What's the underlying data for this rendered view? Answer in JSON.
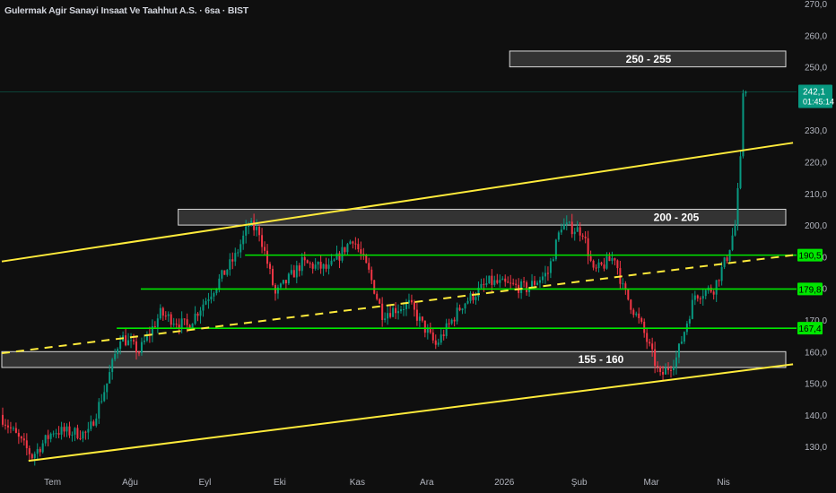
{
  "header": {
    "title": "Gulermak Agir Sanayi Insaat Ve Taahhut A.S. · 6sa · BIST"
  },
  "colors": {
    "background": "#0f0f0f",
    "up": "#089981",
    "down": "#f23645",
    "trendline": "#ffeb3b",
    "level": "#00e600",
    "zone_fill": "#3a3a3a",
    "zone_border": "#d9d9d9",
    "last_price": "#089981"
  },
  "chart_data": {
    "type": "candlestick",
    "title": "Gulermak Agir Sanayi Insaat Ve Taahhut A.S. · 6sa · BIST",
    "y_ticks": [
      "270,0",
      "260,0",
      "250,0",
      "240,0",
      "230,0",
      "220,0",
      "210,0",
      "200,0",
      "190,0",
      "180,0",
      "170,0",
      "160,0",
      "150,0",
      "140,0",
      "130,0"
    ],
    "y_tick_values": [
      270,
      260,
      250,
      240,
      230,
      220,
      210,
      200,
      190,
      180,
      170,
      160,
      150,
      140,
      130
    ],
    "ylim": [
      123,
      271
    ],
    "x_ticks": [
      "Tem",
      "Ağu",
      "Eyl",
      "Eki",
      "Kas",
      "Ara",
      "2026",
      "Şub",
      "Mar",
      "Nis"
    ],
    "x_tick_bar_index": [
      19,
      48,
      76,
      104,
      133,
      159,
      188,
      216,
      243,
      270
    ],
    "bar_count": 279,
    "price_path_waypoints": [
      [
        0,
        140
      ],
      [
        12,
        127
      ],
      [
        20,
        135
      ],
      [
        33,
        134
      ],
      [
        40,
        150
      ],
      [
        45,
        165
      ],
      [
        52,
        160
      ],
      [
        60,
        172
      ],
      [
        70,
        168
      ],
      [
        80,
        180
      ],
      [
        88,
        190
      ],
      [
        93,
        200
      ],
      [
        97,
        198
      ],
      [
        103,
        178
      ],
      [
        113,
        188
      ],
      [
        123,
        186
      ],
      [
        132,
        196
      ],
      [
        138,
        185
      ],
      [
        143,
        172
      ],
      [
        153,
        175
      ],
      [
        163,
        162
      ],
      [
        173,
        175
      ],
      [
        183,
        182
      ],
      [
        197,
        180
      ],
      [
        205,
        185
      ],
      [
        210,
        200
      ],
      [
        218,
        198
      ],
      [
        222,
        185
      ],
      [
        230,
        190
      ],
      [
        233,
        180
      ],
      [
        240,
        168
      ],
      [
        247,
        152
      ],
      [
        253,
        158
      ],
      [
        260,
        178
      ],
      [
        267,
        180
      ],
      [
        272,
        190
      ],
      [
        275,
        200
      ],
      [
        277,
        220
      ],
      [
        278,
        242.1
      ]
    ],
    "last_price": {
      "value": 242.1,
      "label": "242,1",
      "countdown": "01:45:14"
    },
    "levels": [
      {
        "value": 190.5,
        "label": "190,5",
        "start_bar": 91
      },
      {
        "value": 179.8,
        "label": "179,8",
        "start_bar": 52
      },
      {
        "value": 167.4,
        "label": "167,4",
        "start_bar": 43
      }
    ],
    "zones": [
      {
        "low": 250,
        "high": 255,
        "label": "250 - 255",
        "start_bar": 190
      },
      {
        "low": 200,
        "high": 205,
        "label": "200 - 205",
        "start_bar": 66
      },
      {
        "low": 155,
        "high": 160,
        "label": "155 - 160",
        "start_bar": 0
      }
    ],
    "trendlines": [
      {
        "name": "channel-upper",
        "from": [
          0,
          188.5
        ],
        "to": [
          296,
          226
        ],
        "style": "solid"
      },
      {
        "name": "channel-lower",
        "from": [
          10,
          125.5
        ],
        "to": [
          296,
          156
        ],
        "style": "solid"
      },
      {
        "name": "channel-mid",
        "from": [
          0,
          159.5
        ],
        "to": [
          296,
          190.5
        ],
        "style": "dashed"
      }
    ]
  }
}
